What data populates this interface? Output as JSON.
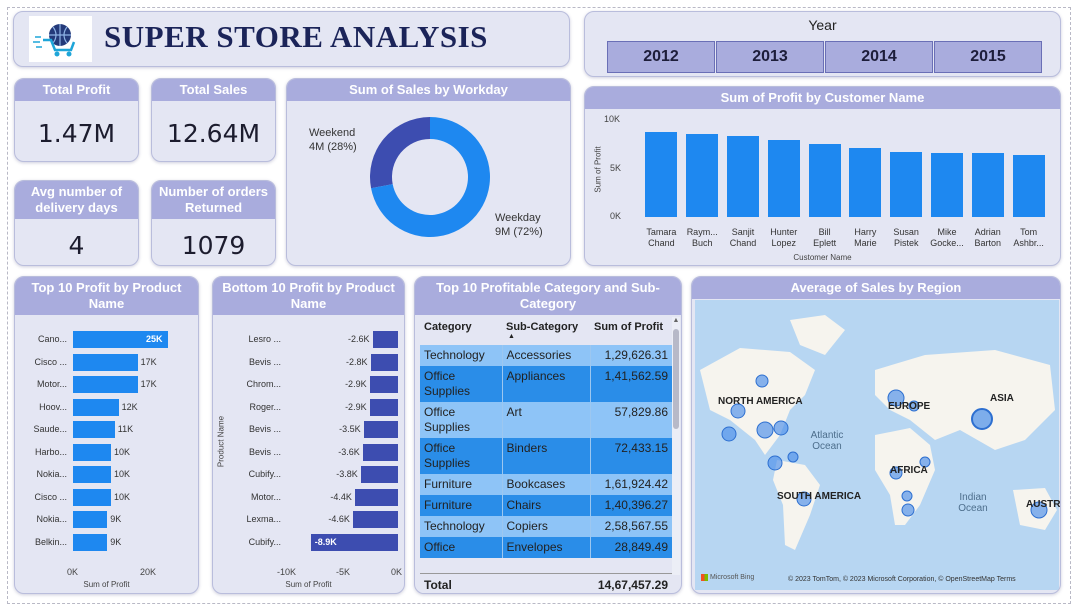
{
  "title": "SUPER STORE ANALYSIS",
  "slicer": {
    "label": "Year",
    "years": [
      "2012",
      "2013",
      "2014",
      "2015"
    ]
  },
  "kpis": {
    "total_profit": {
      "label": "Total Profit",
      "value": "1.47M"
    },
    "total_sales": {
      "label": "Total Sales",
      "value": "12.64M"
    },
    "avg_delivery": {
      "label": "Avg number of delivery days",
      "value": "4"
    },
    "returned": {
      "label": "Number of orders Returned",
      "value": "1079"
    }
  },
  "workday": {
    "title": "Sum of Sales by Workday",
    "chart_data": {
      "type": "pie",
      "slices": [
        {
          "name": "Weekend",
          "value": 4,
          "pct": 28,
          "label": "4M (28%)",
          "color": "#3d4db0"
        },
        {
          "name": "Weekday",
          "value": 9,
          "pct": 72,
          "label": "9M (72%)",
          "color": "#1e88f0"
        }
      ]
    }
  },
  "customer": {
    "title": "Sum of Profit by Customer Name",
    "chart_data": {
      "type": "bar",
      "categories": [
        [
          "Tamara",
          "Chand"
        ],
        [
          "Raym...",
          "Buch"
        ],
        [
          "Sanjit",
          "Chand"
        ],
        [
          "Hunter",
          "Lopez"
        ],
        [
          "Bill",
          "Eplett"
        ],
        [
          "Harry",
          "Marie"
        ],
        [
          "Susan",
          "Pistek"
        ],
        [
          "Mike",
          "Gocke..."
        ],
        [
          "Adrian",
          "Barton"
        ],
        [
          "Tom",
          "Ashbr..."
        ]
      ],
      "values": [
        8700,
        8500,
        8300,
        7900,
        7500,
        7000,
        6600,
        6500,
        6500,
        6300
      ],
      "yticks": [
        "10K",
        "5K",
        "0K"
      ],
      "ylim": [
        0,
        10000
      ],
      "xlabel": "Customer Name",
      "ylabel": "Sum of Profit"
    }
  },
  "top10": {
    "title": "Top 10 Profit by Product Name",
    "chart_data": {
      "type": "bar",
      "categories": [
        "Cano...",
        "Cisco ...",
        "Motor...",
        "Hoov...",
        "Saude...",
        "Harbo...",
        "Nokia...",
        "Cisco ...",
        "Nokia...",
        "Belkin..."
      ],
      "values": [
        25,
        17,
        17,
        12,
        11,
        10,
        10,
        10,
        9,
        9
      ],
      "labels": [
        "25K",
        "17K",
        "17K",
        "12K",
        "11K",
        "10K",
        "10K",
        "10K",
        "9K",
        "9K"
      ],
      "xticks": [
        "0K",
        "20K"
      ],
      "xlim": [
        0,
        25
      ],
      "xlabel": "Sum of Profit"
    }
  },
  "bottom10": {
    "title": "Bottom 10 Profit by Product Name",
    "chart_data": {
      "type": "bar",
      "categories": [
        "Lesro ...",
        "Bevis ...",
        "Chrom...",
        "Roger...",
        "Bevis ...",
        "Bevis ...",
        "Cubify...",
        "Motor...",
        "Lexma...",
        "Cubify..."
      ],
      "values": [
        -2.6,
        -2.8,
        -2.9,
        -2.9,
        -3.5,
        -3.6,
        -3.8,
        -4.4,
        -4.6,
        -8.9
      ],
      "labels": [
        "-2.6K",
        "-2.8K",
        "-2.9K",
        "-2.9K",
        "-3.5K",
        "-3.6K",
        "-3.8K",
        "-4.4K",
        "-4.6K",
        "-8.9K"
      ],
      "xticks": [
        "-10K",
        "-5K",
        "0K"
      ],
      "xlim": [
        -10,
        0
      ],
      "xlabel": "Sum of Profit",
      "ylabel": "Product Name"
    }
  },
  "table": {
    "title": "Top 10 Profitable Category and Sub-Category",
    "headers": [
      "Category",
      "Sub-Category",
      "Sum of Profit"
    ],
    "rows": [
      [
        "Technology",
        "Accessories",
        "1,29,626.31"
      ],
      [
        "Office Supplies",
        "Appliances",
        "1,41,562.59"
      ],
      [
        "Office Supplies",
        "Art",
        "57,829.86"
      ],
      [
        "Office Supplies",
        "Binders",
        "72,433.15"
      ],
      [
        "Furniture",
        "Bookcases",
        "1,61,924.42"
      ],
      [
        "Furniture",
        "Chairs",
        "1,40,396.27"
      ],
      [
        "Technology",
        "Copiers",
        "2,58,567.55"
      ],
      [
        "Office",
        "Envelopes",
        "28,849.49"
      ]
    ],
    "total_label": "Total",
    "total_value": "14,67,457.29"
  },
  "map": {
    "title": "Average of Sales by Region",
    "labels": [
      "NORTH AMERICA",
      "SOUTH AMERICA",
      "EUROPE",
      "AFRICA",
      "ASIA",
      "AUSTRAL",
      "Atlantic Ocean",
      "Indian Ocean"
    ],
    "brand": "Microsoft Bing",
    "attribution": "© 2023 TomTom, © 2023 Microsoft Corporation, © OpenStreetMap  Terms"
  },
  "colors": {
    "bar_blue": "#1e88f0",
    "bar_dark": "#3d4db0",
    "header": "#a9acdd",
    "card": "#e4e6f3"
  }
}
